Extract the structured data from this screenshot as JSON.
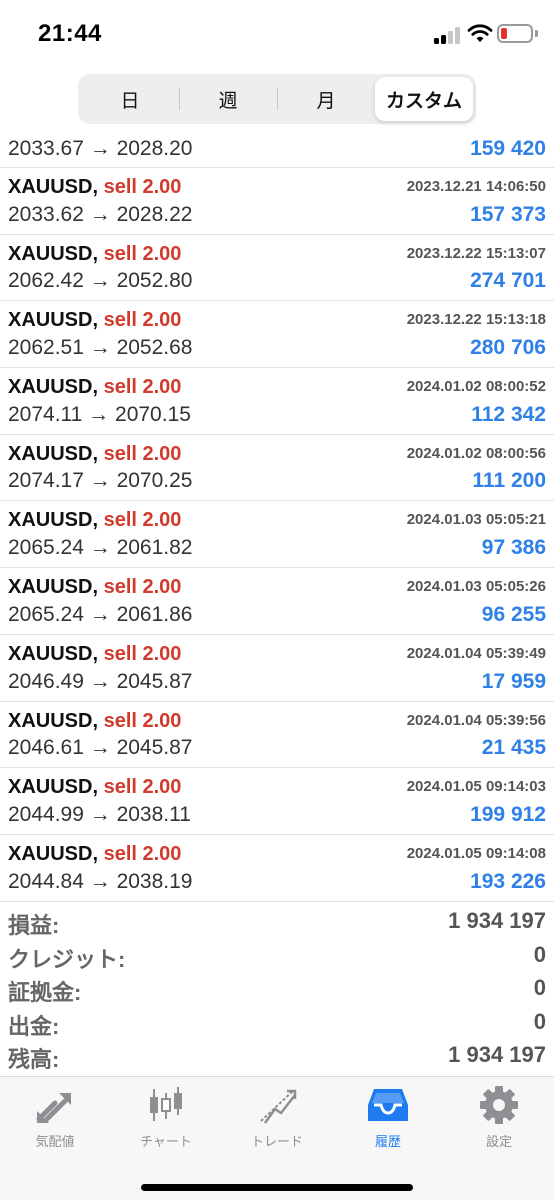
{
  "status_bar": {
    "time": "21:44",
    "icons": [
      "cellular-signal-icon",
      "wifi-icon",
      "battery-low-icon"
    ],
    "battery_color": "#e5322d"
  },
  "period_tabs": [
    {
      "label": "日",
      "active": false
    },
    {
      "label": "週",
      "active": false
    },
    {
      "label": "月",
      "active": false
    },
    {
      "label": "カスタム",
      "active": true
    }
  ],
  "colors": {
    "sell": "#d23a2c",
    "profit": "#2f80e7",
    "tab_active": "#1e7bf0",
    "tab_inactive": "#8e8e93"
  },
  "partial_row": {
    "prices": "2033.67 → 2028.20",
    "profit": "159 420"
  },
  "deals": [
    {
      "symbol": "XAUUSD",
      "comma": ",",
      "side": "sell 2.00",
      "time": "2023.12.21 14:06:50",
      "prices": "2033.62 → 2028.22",
      "profit": "157 373"
    },
    {
      "symbol": "XAUUSD",
      "comma": ",",
      "side": "sell 2.00",
      "time": "2023.12.22 15:13:07",
      "prices": "2062.42 → 2052.80",
      "profit": "274 701"
    },
    {
      "symbol": "XAUUSD",
      "comma": ",",
      "side": "sell 2.00",
      "time": "2023.12.22 15:13:18",
      "prices": "2062.51 → 2052.68",
      "profit": "280 706"
    },
    {
      "symbol": "XAUUSD",
      "comma": ",",
      "side": "sell 2.00",
      "time": "2024.01.02 08:00:52",
      "prices": "2074.11 → 2070.15",
      "profit": "112 342"
    },
    {
      "symbol": "XAUUSD",
      "comma": ",",
      "side": "sell 2.00",
      "time": "2024.01.02 08:00:56",
      "prices": "2074.17 → 2070.25",
      "profit": "111 200"
    },
    {
      "symbol": "XAUUSD",
      "comma": ",",
      "side": "sell 2.00",
      "time": "2024.01.03 05:05:21",
      "prices": "2065.24 → 2061.82",
      "profit": "97 386"
    },
    {
      "symbol": "XAUUSD",
      "comma": ",",
      "side": "sell 2.00",
      "time": "2024.01.03 05:05:26",
      "prices": "2065.24 → 2061.86",
      "profit": "96 255"
    },
    {
      "symbol": "XAUUSD",
      "comma": ",",
      "side": "sell 2.00",
      "time": "2024.01.04 05:39:49",
      "prices": "2046.49 → 2045.87",
      "profit": "17 959"
    },
    {
      "symbol": "XAUUSD",
      "comma": ",",
      "side": "sell 2.00",
      "time": "2024.01.04 05:39:56",
      "prices": "2046.61 → 2045.87",
      "profit": "21 435"
    },
    {
      "symbol": "XAUUSD",
      "comma": ",",
      "side": "sell 2.00",
      "time": "2024.01.05 09:14:03",
      "prices": "2044.99 → 2038.11",
      "profit": "199 912"
    },
    {
      "symbol": "XAUUSD",
      "comma": ",",
      "side": "sell 2.00",
      "time": "2024.01.05 09:14:08",
      "prices": "2044.84 → 2038.19",
      "profit": "193 226"
    }
  ],
  "summary": [
    {
      "label": "損益:",
      "value": "1 934 197"
    },
    {
      "label": "クレジット:",
      "value": "0"
    },
    {
      "label": "証拠金:",
      "value": "0"
    },
    {
      "label": "出金:",
      "value": "0"
    },
    {
      "label": "残高:",
      "value": "1 934 197"
    }
  ],
  "tab_bar": [
    {
      "label": "気配値",
      "icon": "quotes-arrows-icon",
      "active": false
    },
    {
      "label": "チャート",
      "icon": "candlestick-chart-icon",
      "active": false
    },
    {
      "label": "トレード",
      "icon": "trade-trend-icon",
      "active": false
    },
    {
      "label": "履歴",
      "icon": "history-inbox-icon",
      "active": true
    },
    {
      "label": "設定",
      "icon": "gear-icon",
      "active": false
    }
  ]
}
